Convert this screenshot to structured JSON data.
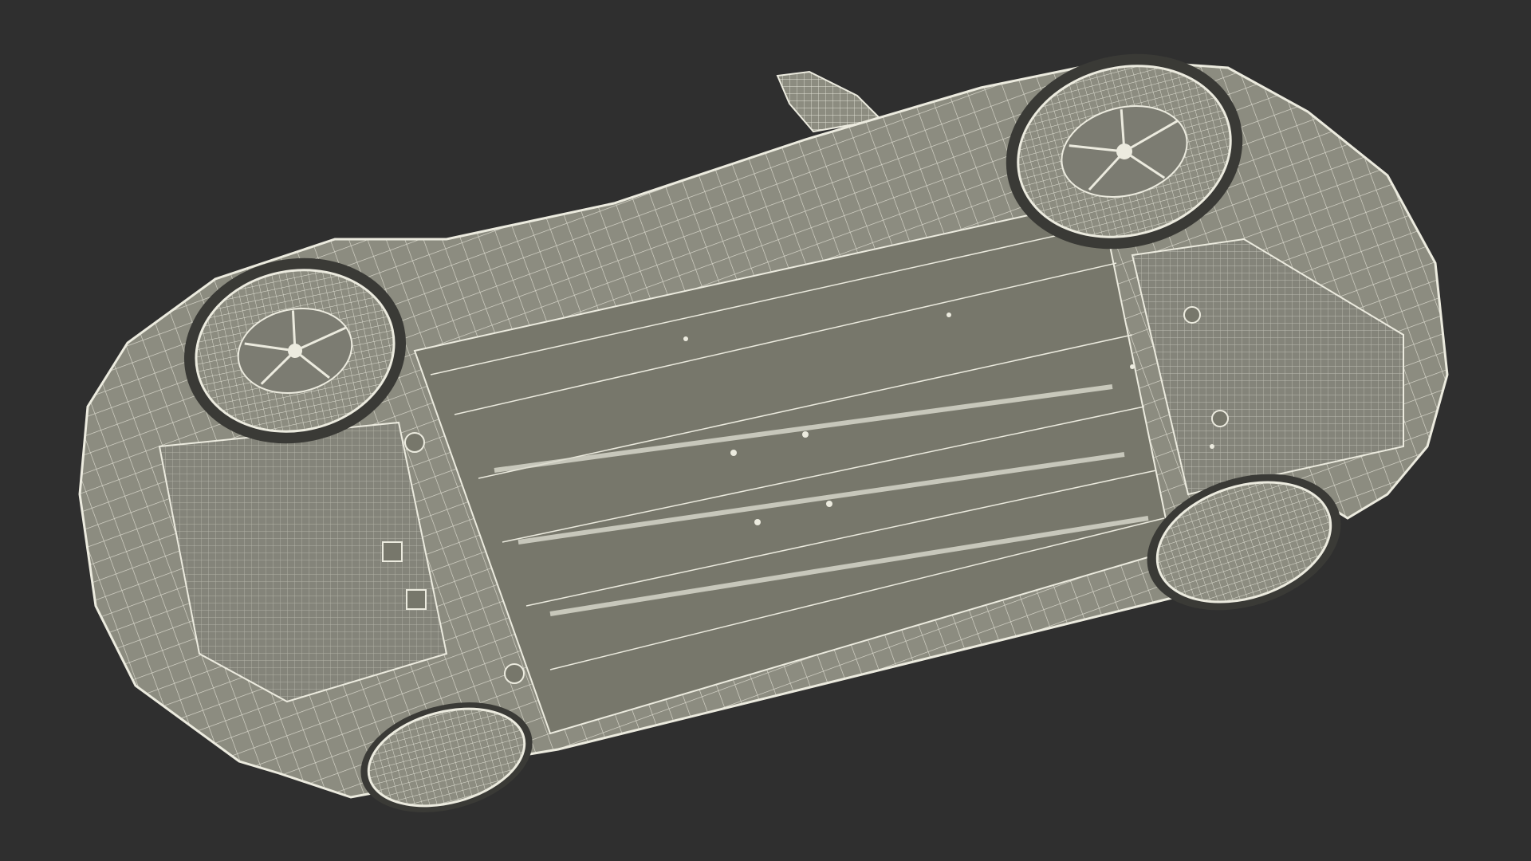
{
  "viewport": {
    "background_color": "#2f2f2f",
    "body_color": "#8c8c80",
    "panel_color": "#77776b",
    "wire_color": "#ecebdf",
    "wheel_well_color": "#3a3a36"
  },
  "subject": {
    "icon": "car-underside-wireframe-icon"
  }
}
